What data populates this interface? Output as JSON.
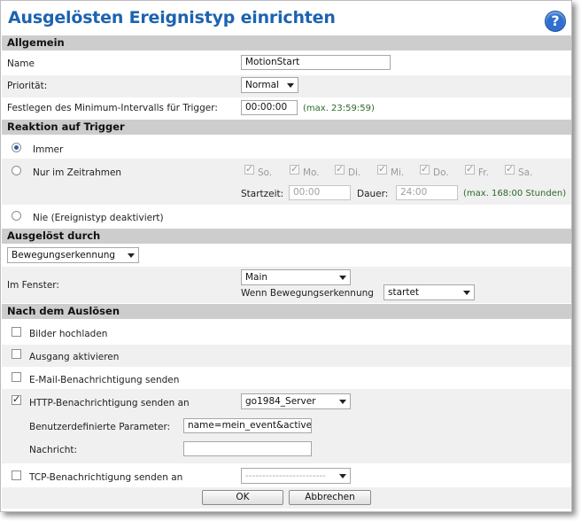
{
  "title": "Ausgelösten Ereignistyp einrichten",
  "help_label": "?",
  "general": {
    "heading": "Allgemein",
    "name_label": "Name",
    "name_value": "MotionStart",
    "priority_label": "Priorität:",
    "priority_value": "Normal",
    "interval_label": "Festlegen des Minimum-Intervalls für Trigger:",
    "interval_value": "00:00:00",
    "interval_hint": "(max. 23:59:59)"
  },
  "response": {
    "heading": "Reaktion auf Trigger",
    "always_label": "Immer",
    "timeframe_label": "Nur im Zeitrahmen",
    "days": [
      {
        "label": "So.",
        "checked": true
      },
      {
        "label": "Mo.",
        "checked": true
      },
      {
        "label": "Di.",
        "checked": true
      },
      {
        "label": "Mi.",
        "checked": true
      },
      {
        "label": "Do.",
        "checked": true
      },
      {
        "label": "Fr.",
        "checked": true
      },
      {
        "label": "Sa.",
        "checked": true
      }
    ],
    "start_label": "Startzeit:",
    "start_value": "00:00",
    "duration_label": "Dauer:",
    "duration_value": "24:00",
    "duration_hint": "(max. 168:00 Stunden)",
    "never_label": "Nie (Ereignistyp deaktiviert)",
    "selected": "Immer"
  },
  "triggered": {
    "heading": "Ausgelöst durch",
    "source_value": "Bewegungserkennung",
    "window_label": "Im Fenster:",
    "window_value": "Main",
    "when_label": "Wenn Bewegungserkennung",
    "when_value": "startet"
  },
  "after": {
    "heading": "Nach dem Auslösen",
    "upload_label": "Bilder hochladen",
    "upload_checked": false,
    "output_label": "Ausgang aktivieren",
    "output_checked": false,
    "email_label": "E-Mail-Benachrichtigung senden",
    "email_checked": false,
    "http_label": "HTTP-Benachrichtigung senden an",
    "http_checked": true,
    "http_server": "go1984_Server",
    "params_label": "Benutzerdefinierte Parameter:",
    "params_value": "name=mein_event&active",
    "message_label": "Nachricht:",
    "message_value": "",
    "tcp_label": "TCP-Benachrichtigung senden an",
    "tcp_checked": false,
    "tcp_value": "------------------------"
  },
  "buttons": {
    "ok": "OK",
    "cancel": "Abbrechen"
  }
}
